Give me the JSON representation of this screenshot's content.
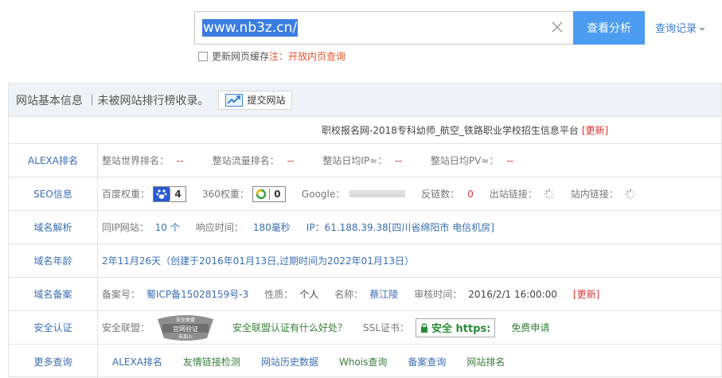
{
  "search": {
    "value": "www.nb3z.cn/",
    "button": "查看分析",
    "history": "查询记录",
    "cache_label": "更新网页缓存",
    "cache_note": "注：开放内页查询"
  },
  "panel": {
    "title": "网站基本信息 ｜未被网站排行榜收录。",
    "submit_btn": "提交网站",
    "site_title": "职校报名网-2018专科幼师_航空_铁路职业学校招生信息平台",
    "update": "[更新]"
  },
  "rows": {
    "alexa": {
      "label": "ALEXA排名",
      "world_rank": "整站世界排名：",
      "world_rank_val": "--",
      "traffic_rank": "整站流量排名：",
      "traffic_rank_val": "--",
      "daily_ip": "整站日均IP≈：",
      "daily_ip_val": "--",
      "daily_pv": "整站日均PV≈：",
      "daily_pv_val": "--"
    },
    "seo": {
      "label": "SEO信息",
      "baidu": "百度权重：",
      "baidu_val": "4",
      "s360": "360权重：",
      "s360_val": "0",
      "google": "Google：",
      "backlinks": "反链数：",
      "backlinks_val": "0",
      "outbound": "出站链接：",
      "inbound": "站内链接："
    },
    "dns": {
      "label": "域名解析",
      "same_ip": "同IP网站：",
      "same_ip_val": "10 个",
      "response": "响应时间：",
      "response_val": "180毫秒",
      "ip": "IP：61.188.39.38[四川省绵阳市 电信机房]"
    },
    "age": {
      "label": "域名年龄",
      "text": "2年11月26天（创建于2016年01月13日,过期时间为2022年01月13日）"
    },
    "icp": {
      "label": "域名备案",
      "no": "备案号：",
      "no_val": "蜀ICP备15028159号-3",
      "nature": "性质：",
      "nature_val": "个人",
      "name": "名称：",
      "name_val": "蔡江陵",
      "time": "审核时间：",
      "time_val": "2016/2/1 16:00:00",
      "update": "[更新]"
    },
    "security": {
      "label": "安全认证",
      "alliance": "安全联盟：",
      "benefit": "安全联盟认证有什么好处？",
      "ssl": "SSL证书：",
      "ssl_btn": "安全 https:",
      "apply": "免费申请",
      "seal_top": "安全联盟",
      "seal_mid": "官网验证",
      "seal_bot": "未加入"
    },
    "more": {
      "label": "更多查询",
      "links": [
        "ALEXA排名",
        "友情链接检测",
        "网站历史数据",
        "Whois查询",
        "备案查询",
        "网站排名"
      ]
    }
  }
}
